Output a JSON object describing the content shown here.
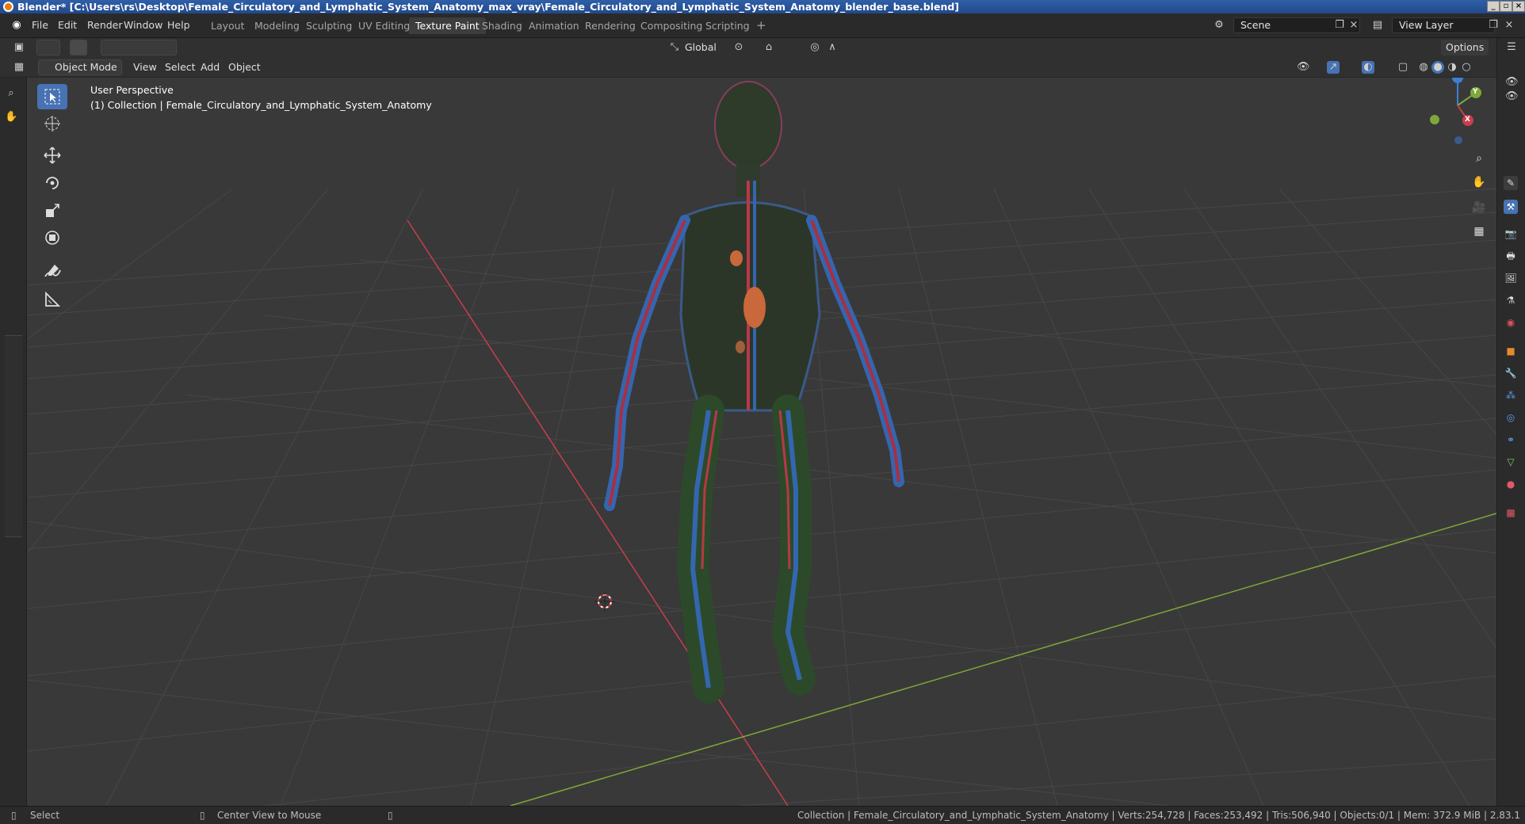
{
  "window": {
    "title": "Blender* [C:\\Users\\rs\\Desktop\\Female_Circulatory_and_Lymphatic_System_Anatomy_max_vray\\Female_Circulatory_and_Lymphatic_System_Anatomy_blender_base.blend]"
  },
  "menu": [
    "File",
    "Edit",
    "Render",
    "Window",
    "Help"
  ],
  "workspaces": [
    {
      "label": "Layout",
      "active": false
    },
    {
      "label": "Modeling",
      "active": false
    },
    {
      "label": "Sculpting",
      "active": false
    },
    {
      "label": "UV Editing",
      "active": false
    },
    {
      "label": "Texture Paint",
      "active": true
    },
    {
      "label": "Shading",
      "active": false
    },
    {
      "label": "Animation",
      "active": false
    },
    {
      "label": "Rendering",
      "active": false
    },
    {
      "label": "Compositing",
      "active": false
    },
    {
      "label": "Scripting",
      "active": false
    }
  ],
  "add_workspace_label": "+",
  "scene": {
    "name": "Scene"
  },
  "view_layer": {
    "name": "View Layer"
  },
  "tool_header": {
    "orientation": "Global",
    "options_label": "Options"
  },
  "view_header": {
    "mode": "Object Mode",
    "menus": [
      "View",
      "Select",
      "Add",
      "Object"
    ]
  },
  "viewport": {
    "perspective_label": "User Perspective",
    "collection_label": "(1) Collection | Female_Circulatory_and_Lymphatic_System_Anatomy",
    "gizmo_axes": {
      "x": "X",
      "y": "Y",
      "z": "Z"
    }
  },
  "tools": [
    {
      "name": "select-box-tool",
      "icon": "cursor-select-icon",
      "active": true
    },
    {
      "name": "cursor-tool",
      "icon": "3d-cursor-icon",
      "active": false
    },
    {
      "name": "move-tool",
      "icon": "move-icon",
      "active": false
    },
    {
      "name": "rotate-tool",
      "icon": "rotate-icon",
      "active": false
    },
    {
      "name": "scale-tool",
      "icon": "scale-icon",
      "active": false
    },
    {
      "name": "transform-tool",
      "icon": "transform-icon",
      "active": false
    },
    {
      "name": "annotate-tool",
      "icon": "annotate-icon",
      "active": false
    },
    {
      "name": "measure-tool",
      "icon": "measure-icon",
      "active": false
    }
  ],
  "status": {
    "left_action": "Select",
    "middle_action": "Center View to Mouse",
    "stats": "Collection | Female_Circulatory_and_Lymphatic_System_Anatomy | Verts:254,728 | Faces:253,492 | Tris:506,940 | Objects:0/1 | Mem: 372.9 MiB | 2.83.1"
  },
  "colors": {
    "accent": "#4772b3",
    "x_axis": "#c83e4d",
    "y_axis": "#7fa83a",
    "z_axis": "#3b7fd6",
    "grid_bg": "#3b3b3b"
  }
}
